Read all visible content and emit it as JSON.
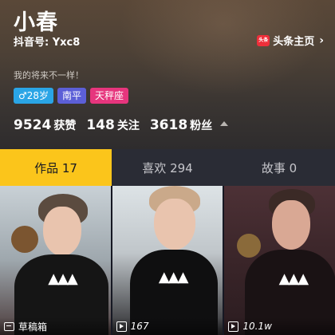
{
  "profile": {
    "name": "小春",
    "douyin_id": "抖音号: Yxc8",
    "signature": "我的将来不一样！",
    "home_link": {
      "icon_text": "头条",
      "label": "头条主页",
      "chevron": "›"
    },
    "tags": {
      "age": "♂28岁",
      "city": "南平",
      "zodiac": "天秤座"
    },
    "stats": {
      "likes_num": "9524",
      "likes_label": "获赞",
      "following_num": "148",
      "following_label": "关注",
      "fans_num": "3618",
      "fans_label": "粉丝"
    }
  },
  "tabs": [
    {
      "label": "作品 17",
      "active": true
    },
    {
      "label": "喜欢 294",
      "active": false
    },
    {
      "label": "故事 0",
      "active": false
    }
  ],
  "videos": [
    {
      "type": "draft",
      "label": "草稿箱"
    },
    {
      "type": "play",
      "label": "167"
    },
    {
      "type": "play",
      "label": "10.1w"
    }
  ],
  "colors": {
    "active_tab": "#fbc51b",
    "tag_age": "#2aa5e6",
    "tag_city": "#5c5fd7",
    "tag_zodiac": "#e6357d",
    "toutiao_red": "#ed2f3a"
  }
}
